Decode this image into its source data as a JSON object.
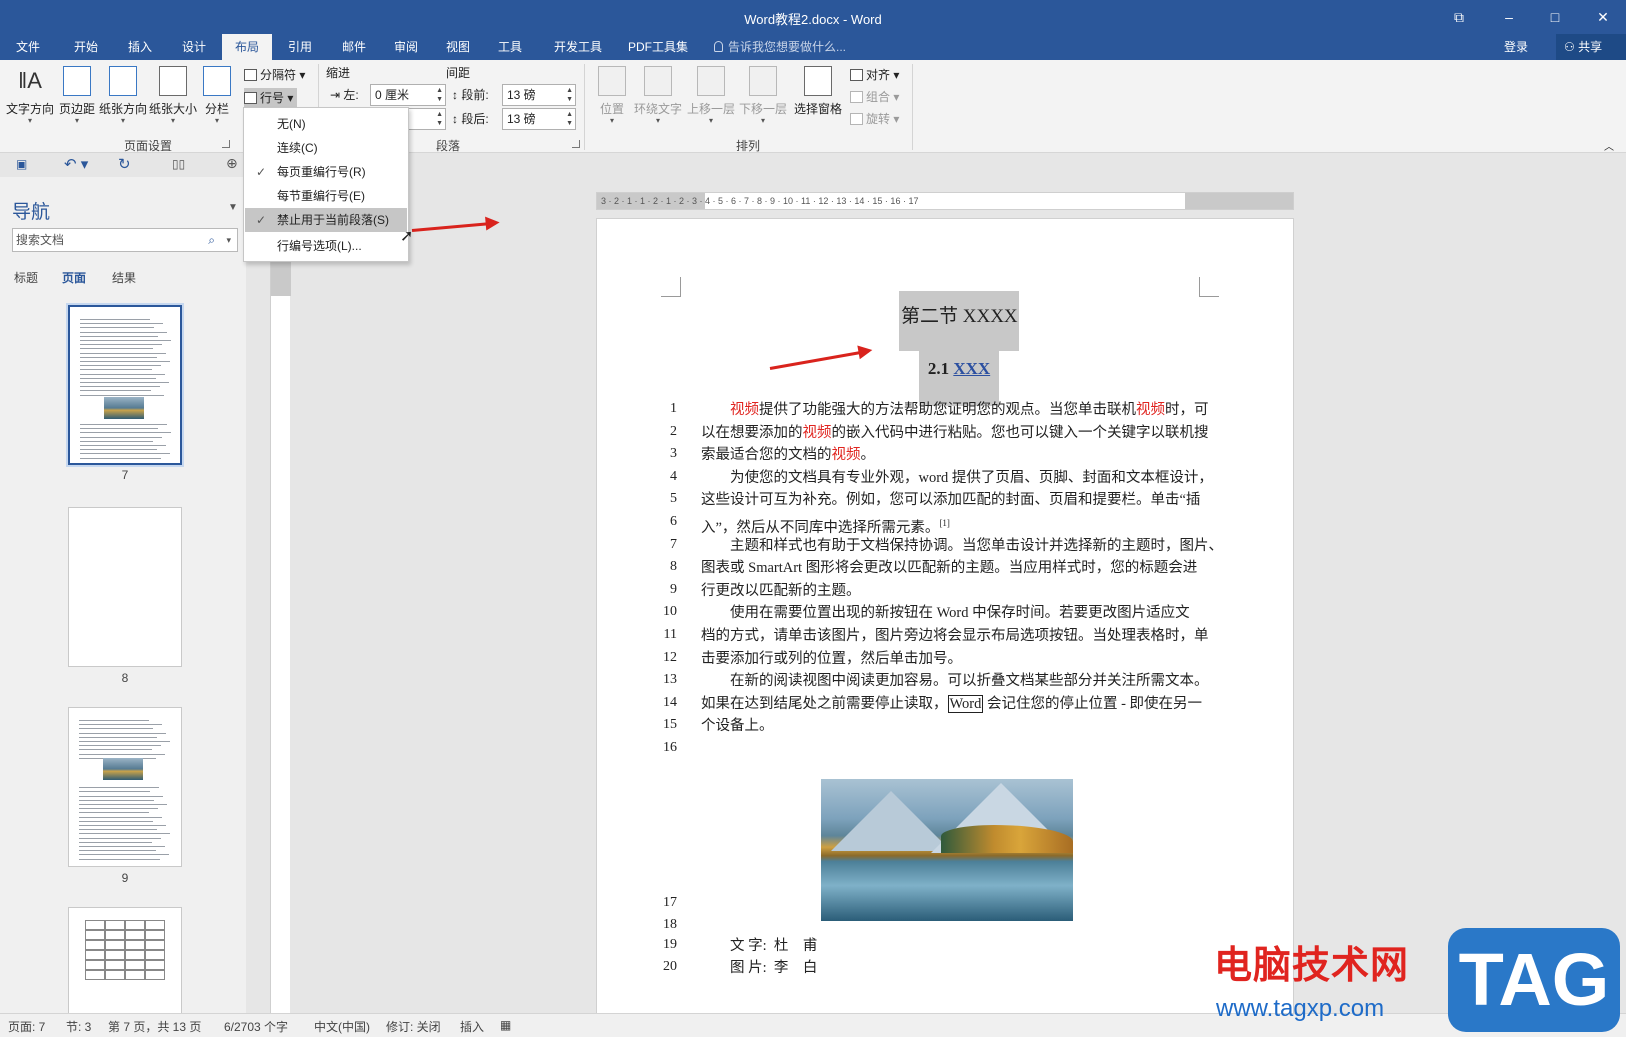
{
  "window": {
    "title": "Word教程2.docx - Word"
  },
  "tabs": [
    "文件",
    "开始",
    "插入",
    "设计",
    "布局",
    "引用",
    "邮件",
    "审阅",
    "视图",
    "工具",
    "开发工具",
    "PDF工具集"
  ],
  "active_tab": "布局",
  "tell_me": "告诉我您想要做什么...",
  "login": "登录",
  "share": "共享",
  "ribbon": {
    "page_setup": {
      "text_direction": "文字方向",
      "margins": "页边距",
      "orientation": "纸张方向",
      "size": "纸张大小",
      "columns": "分栏",
      "breaks": "分隔符",
      "line_numbers": "行号",
      "group_label": "页面设置"
    },
    "paragraph": {
      "indent_label": "缩进",
      "spacing_label": "间距",
      "left_label": "左:",
      "left_value": "0 厘米",
      "before_label": "段前:",
      "before_value": "13 磅",
      "after_label": "段后:",
      "after_value": "13 磅",
      "group_label": "段落"
    },
    "arrange": {
      "position": "位置",
      "wrap_text": "环绕文字",
      "bring_forward": "上移一层",
      "send_backward": "下移一层",
      "selection_pane": "选择窗格",
      "align": "对齐",
      "group": "组合",
      "rotate": "旋转",
      "group_label": "排列"
    }
  },
  "dropdown": {
    "items": [
      {
        "label": "无(N)",
        "checked": false
      },
      {
        "label": "连续(C)",
        "checked": false
      },
      {
        "label": "每页重编行号(R)",
        "checked": true
      },
      {
        "label": "每节重编行号(E)",
        "checked": false
      },
      {
        "label": "禁止用于当前段落(S)",
        "checked": true,
        "highlighted": true
      },
      {
        "label": "行编号选项(L)...",
        "checked": false
      }
    ]
  },
  "nav": {
    "title": "导航",
    "search_placeholder": "搜索文档",
    "tabs": [
      "标题",
      "页面",
      "结果"
    ],
    "active_tab": "页面",
    "pages": [
      "7",
      "8",
      "9"
    ]
  },
  "ruler": {
    "numbers": "3 · 2 · 1 · 1 · 2 · 1 · 2 · 3 · 4 · 5 · 6 · 7 · 8 · 9 · 10 · 11 · 12 · 13 · 14 · 15 · 16 · 17"
  },
  "document": {
    "heading1": "第二节  XXXX",
    "heading2_prefix": "2.1 ",
    "heading2_link": "XXX",
    "lines": [
      {
        "n": "1",
        "indent": true,
        "parts": [
          [
            "视频",
            "red"
          ],
          [
            "提供了功能强大的方法帮助您证明您的观点。当您单击联机",
            ""
          ],
          [
            "视频",
            "red"
          ],
          [
            "时，可",
            ""
          ]
        ]
      },
      {
        "n": "2",
        "indent": false,
        "parts": [
          [
            "以在想要添加的",
            ""
          ],
          [
            "视频",
            "red"
          ],
          [
            "的嵌入代码中进行粘贴。您也可以键入一个关键字以联机搜",
            ""
          ]
        ]
      },
      {
        "n": "3",
        "indent": false,
        "parts": [
          [
            "索最适合您的文档的",
            ""
          ],
          [
            "视频",
            "red"
          ],
          [
            "。",
            ""
          ]
        ]
      },
      {
        "n": "4",
        "indent": true,
        "parts": [
          [
            "为使您的文档具有专业外观，word 提供了页眉、页脚、封面和文本框设计，",
            ""
          ]
        ]
      },
      {
        "n": "5",
        "indent": false,
        "parts": [
          [
            "这些设计可互为补充。例如，您可以添加匹配的封面、页眉和提要栏。单击“插",
            ""
          ]
        ]
      },
      {
        "n": "6",
        "indent": false,
        "parts": [
          [
            "入”，然后从不同库中选择所需元素。",
            ""
          ],
          [
            "[1]",
            "sup"
          ]
        ]
      },
      {
        "n": "7",
        "indent": true,
        "parts": [
          [
            "主题和样式也有助于文档保持协调。当您单击设计并选择新的主题时，图片、",
            ""
          ]
        ]
      },
      {
        "n": "8",
        "indent": false,
        "parts": [
          [
            "图表或 SmartArt 图形将会更改以匹配新的主题。当应用样式时，您的标题会进",
            ""
          ]
        ]
      },
      {
        "n": "9",
        "indent": false,
        "parts": [
          [
            "行更改以匹配新的主题。",
            ""
          ]
        ]
      },
      {
        "n": "10",
        "indent": true,
        "parts": [
          [
            "使用在需要位置出现的新按钮在 Word 中保存时间。若要更改图片适应文",
            ""
          ]
        ]
      },
      {
        "n": "11",
        "indent": false,
        "parts": [
          [
            "档的方式，请单击该图片，图片旁边将会显示布局选项按钮。当处理表格时，单",
            ""
          ]
        ]
      },
      {
        "n": "12",
        "indent": false,
        "parts": [
          [
            "击要添加行或列的位置，然后单击加号。",
            ""
          ]
        ]
      },
      {
        "n": "13",
        "indent": true,
        "parts": [
          [
            "在新的阅读视图中阅读更加容易。可以折叠文档某些部分并关注所需文本。",
            ""
          ]
        ]
      },
      {
        "n": "14",
        "indent": false,
        "parts": [
          [
            "如果在达到结尾处之前需要停止读取，",
            ""
          ],
          [
            "Word",
            "boxed"
          ],
          [
            " 会记住您的停止位置 - 即使在另一",
            ""
          ]
        ]
      },
      {
        "n": "15",
        "indent": false,
        "parts": [
          [
            "个设备上。",
            ""
          ]
        ]
      },
      {
        "n": "16",
        "indent": false,
        "parts": []
      }
    ],
    "after_image_lines": [
      {
        "n": "17",
        "text": ""
      },
      {
        "n": "18",
        "text": ""
      },
      {
        "n": "19",
        "text": "文 字:  杜    甫"
      },
      {
        "n": "20",
        "text": "图 片:  李    白"
      }
    ]
  },
  "status": {
    "page": "页面: 7",
    "section": "节: 3",
    "page_of": "第 7 页，共 13 页",
    "words": "6/2703 个字",
    "language": "中文(中国)",
    "track": "修订: 关闭",
    "mode": "插入"
  },
  "watermark": {
    "text": "电脑技术网",
    "url": "www.tagxp.com",
    "logo": "TAG"
  },
  "colors": {
    "brand": "#2b579a",
    "red_text": "#e0241f",
    "arrow": "#d9231d"
  }
}
